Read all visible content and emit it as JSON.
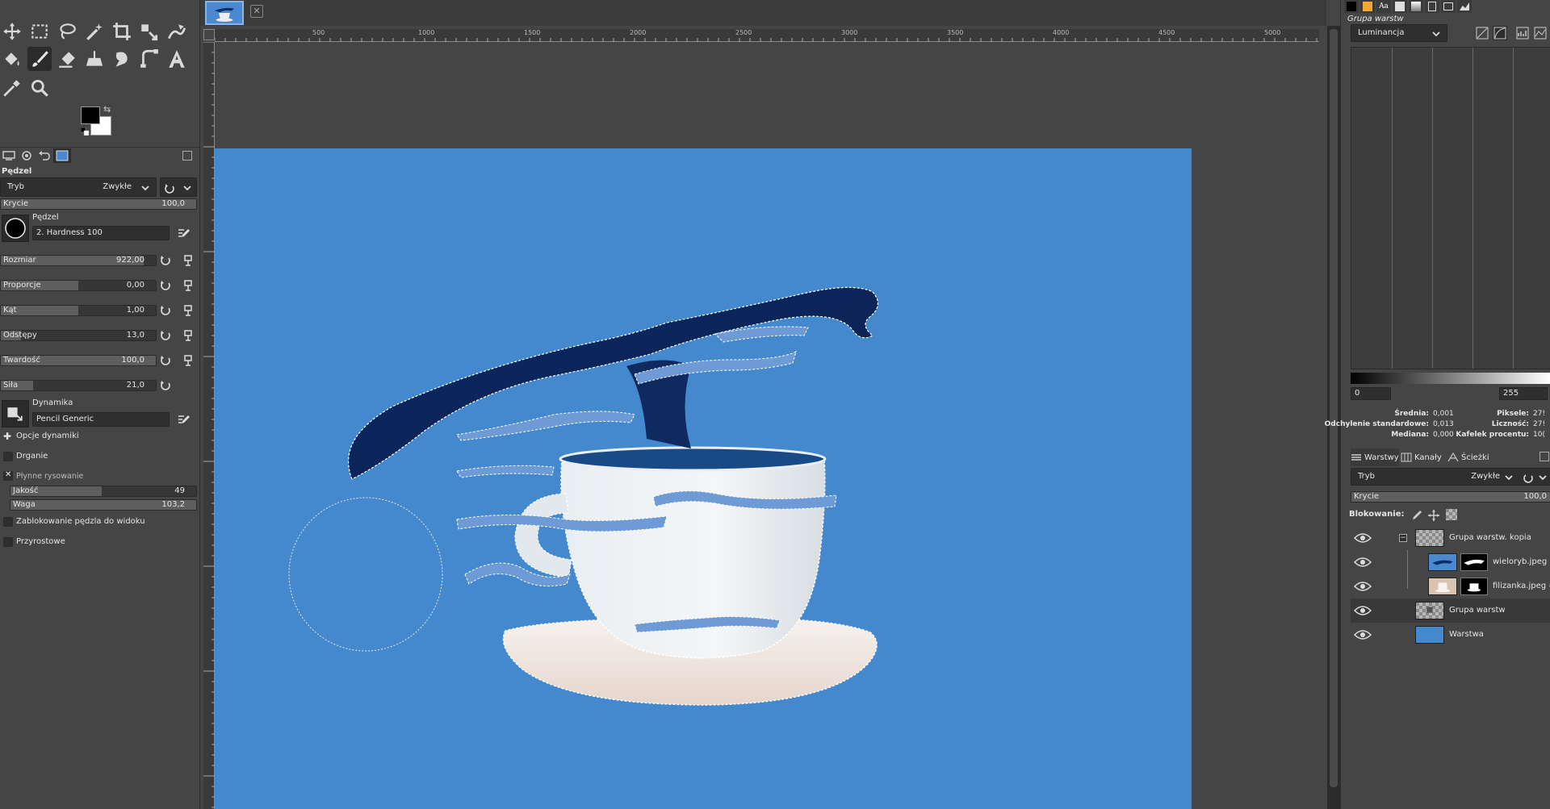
{
  "tool_options": {
    "tool_name": "Pędzel",
    "mode_label": "Tryb",
    "mode_value": "Zwykłe",
    "opacity": {
      "label": "Krycie",
      "value": "100,0",
      "fraction": 1.0
    },
    "brush_label": "Pędzel",
    "brush_name": "2. Hardness 100",
    "sliders": [
      {
        "label": "Rozmiar",
        "value": "922,00",
        "fraction": 0.92
      },
      {
        "label": "Proporcje",
        "value": "0,00",
        "fraction": 0.5
      },
      {
        "label": "Kąt",
        "value": "1,00",
        "fraction": 0.5
      },
      {
        "label": "Odstępy",
        "value": "13,0",
        "fraction": 0.13
      },
      {
        "label": "Twardość",
        "value": "100,0",
        "fraction": 1.0
      },
      {
        "label": "Siła",
        "value": "21,0",
        "fraction": 0.21
      }
    ],
    "dynamics_label": "Dynamika",
    "dynamics_name": "Pencil Generic",
    "dynamics_options_label": "Opcje dynamiki",
    "jitter_label": "Drganie",
    "smooth_stroke_label": "Płynne rysowanie",
    "smooth_quality": {
      "label": "Jakość",
      "value": "49",
      "fraction": 0.49
    },
    "smooth_weight": {
      "label": "Waga",
      "value": "103,2",
      "fraction": 1.0
    },
    "lock_brush_label": "Zablokowanie pędzla do widoku",
    "incremental_label": "Przyrostowe"
  },
  "ruler": {
    "ticks": [
      "500",
      "1000",
      "1500",
      "2000",
      "2500",
      "3000",
      "3500",
      "4000",
      "4500",
      "5000"
    ]
  },
  "histogram": {
    "layer_name": "Grupa warstw",
    "channel": "Luminancja",
    "range_min": "0",
    "range_max": "255",
    "stats_left": [
      {
        "label": "Średnia:",
        "value": "0,001"
      },
      {
        "label": "Odchylenie standardowe:",
        "value": "0,013"
      },
      {
        "label": "Mediana:",
        "value": "0,000"
      }
    ],
    "stats_right": [
      {
        "label": "Piksele:",
        "value": "27!"
      },
      {
        "label": "Liczność:",
        "value": "27!"
      },
      {
        "label": "Kafelek procentu:",
        "value": "10("
      }
    ]
  },
  "layers_panel": {
    "tabs": [
      "Warstwy",
      "Kanały",
      "Ścieżki"
    ],
    "mode_label": "Tryb",
    "mode_value": "Zwykłe",
    "opacity_label": "Krycie",
    "opacity_value": "100,0",
    "lock_label": "Blokowanie:",
    "layers": [
      {
        "name": "Grupa warstw. kopia"
      },
      {
        "name": "wieloryb.jpeg #"
      },
      {
        "name": "filizanka.jpeg #"
      },
      {
        "name": "Grupa warstw"
      },
      {
        "name": "Warstwa"
      }
    ]
  },
  "colors": {
    "canvas_blue": "#4489ce",
    "foreground": "#000000",
    "background": "#ffffff"
  }
}
